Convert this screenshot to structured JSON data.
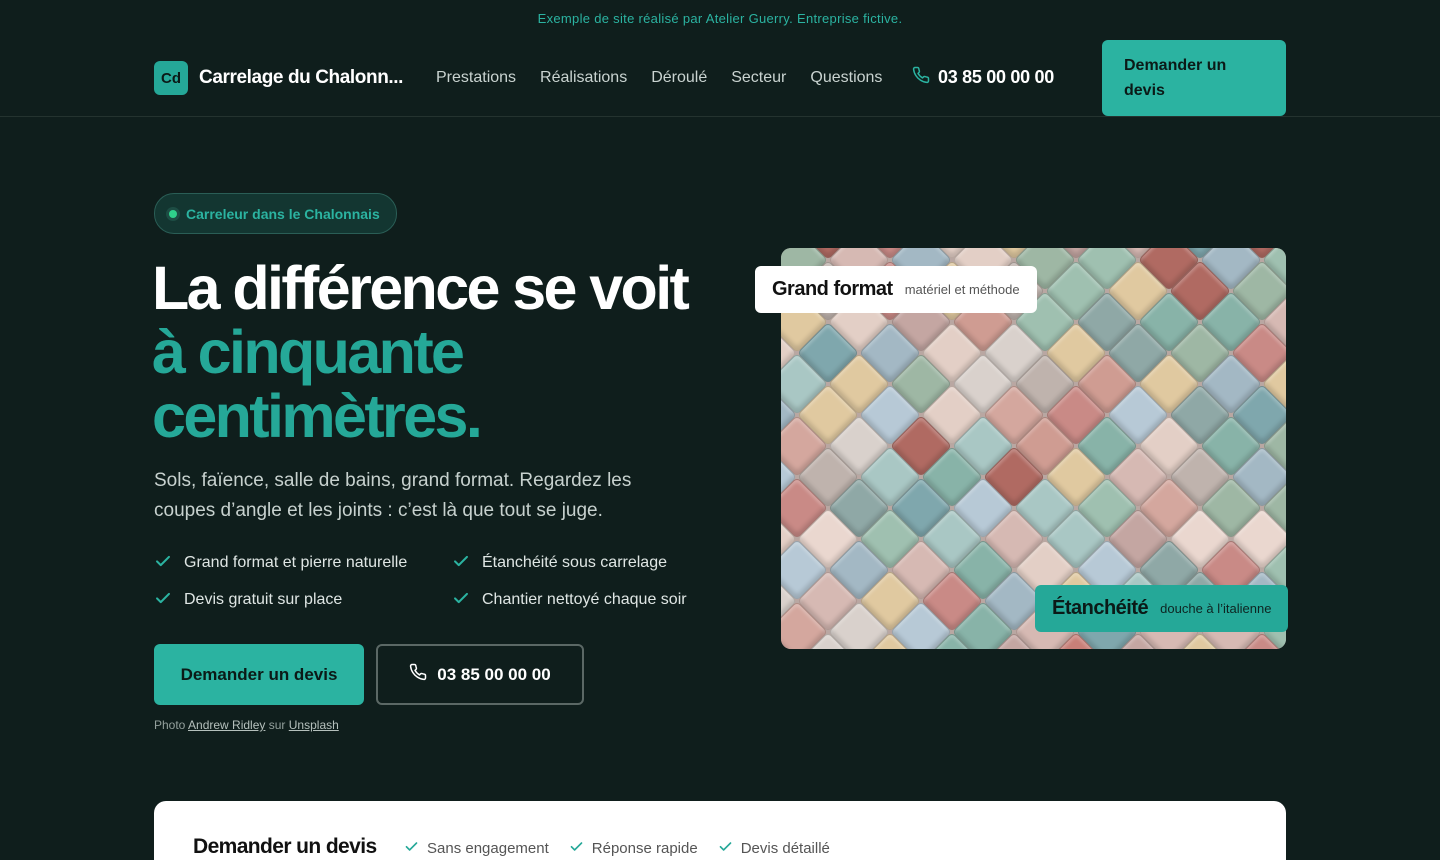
{
  "banner": "Exemple de site réalisé par Atelier Guerry. Entreprise fictive.",
  "header": {
    "logo_initials": "Cd",
    "brand": "Carrelage du Chalonn...",
    "nav": [
      "Prestations",
      "Réalisations",
      "Déroulé",
      "Secteur",
      "Questions"
    ],
    "phone": "03 85 00 00 00",
    "cta": "Demander un devis"
  },
  "hero": {
    "badge": "Carreleur dans le Chalonnais",
    "headline_line1": "La différence se voit",
    "headline_line2": "à cinquante",
    "headline_line3": "centimètres",
    "headline_dot": ".",
    "lead": "Sols, faïence, salle de bains, grand format. Regardez les coupes d’angle et les joints : c’est là que tout se juge.",
    "checks": [
      "Grand format et pierre naturelle",
      "Étanchéité sous carrelage",
      "Devis gratuit sur place",
      "Chantier nettoyé chaque soir"
    ],
    "primary_button": "Demander un devis",
    "phone_button": "03 85 00 00 00",
    "credit_prefix": "Photo",
    "credit_author": "Andrew Ridley",
    "credit_mid": "sur",
    "credit_site": "Unsplash"
  },
  "photo": {
    "tag_top_title": "Grand format",
    "tag_top_sub": "matériel et méthode",
    "tag_bottom_title": "Étanchéité",
    "tag_bottom_sub": "douche à l’italienne"
  },
  "quote": {
    "title": "Demander un devis",
    "pills": [
      "Sans engagement",
      "Réponse rapide",
      "Devis détaillé"
    ]
  },
  "colors": {
    "background": "#0f1e1c",
    "accent": "#2bb3a1",
    "accent_dark": "#25a898"
  }
}
